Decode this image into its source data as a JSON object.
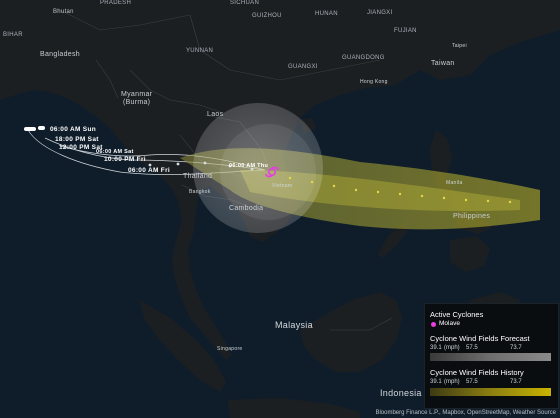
{
  "labels": {
    "bhutan": "Bhutan",
    "pradesh": "PRADESH",
    "sichuan": "SICHUAN",
    "guizhou": "GUIZHOU",
    "hunan": "HUNAN",
    "jiangxi": "JIANGXI",
    "fujian": "FUJIAN",
    "bihar": "BIHAR",
    "bangladesh": "Bangladesh",
    "yunnan": "YUNNAN",
    "guangxi": "GUANGXI",
    "guangdong": "GUANGDONG",
    "taipei": "Taipei",
    "taiwan": "Taiwan",
    "hongkong": "Hong Kong",
    "myanmar": "Myanmar\n(Burma)",
    "laos": "Laos",
    "thailand": "Thailand",
    "bangkok": "Bangkok",
    "cambodia": "Cambodia",
    "vietnam": "Vietnam",
    "manila": "Manila",
    "philippines": "Philippines",
    "malaysia": "Malaysia",
    "singapore": "Singapore",
    "indonesia": "Indonesia"
  },
  "track_labels": {
    "sun": "06:00 AM Sun",
    "sat6pm": "18:00 PM Sat",
    "sat12pm": "12:00 PM Sat",
    "sat6am": "06:00 AM Sat",
    "fri10pm": "10:00 PM Fri",
    "fri6am": "06:00 AM Fri",
    "thu": "06:00 AM Thu"
  },
  "legend": {
    "title": "Active Cyclones",
    "storm_name": "Molave",
    "forecast_title": "Cyclone Wind Fields Forecast",
    "history_title": "Cyclone Wind Fields History",
    "scale_low": "39.1",
    "scale_unit": "(mph)",
    "scale_mid": "57.5",
    "scale_high": "73.7",
    "storm_color": "#e83ee0",
    "forecast_bar_color": "#8a8a8a",
    "history_bar_color": "#c9b300"
  },
  "attribution": "Bloomberg Finance L.P., Mapbox, OpenStreetMap, Weather Source"
}
